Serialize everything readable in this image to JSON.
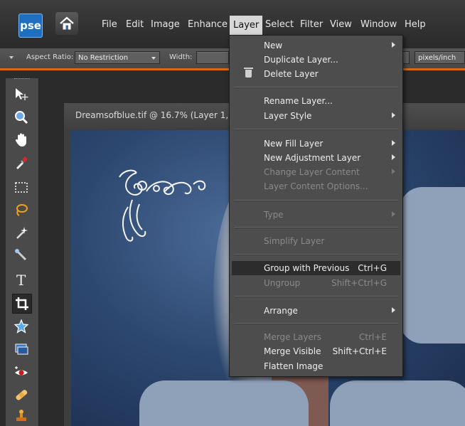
{
  "app": {
    "logo_text": "pse"
  },
  "menubar": {
    "items": [
      {
        "label": "File"
      },
      {
        "label": "Edit"
      },
      {
        "label": "Image"
      },
      {
        "label": "Enhance"
      },
      {
        "label": "Layer"
      },
      {
        "label": "Select"
      },
      {
        "label": "Filter"
      },
      {
        "label": "View"
      },
      {
        "label": "Window"
      },
      {
        "label": "Help"
      }
    ],
    "active": "Layer"
  },
  "options_bar": {
    "aspect_ratio_label": "Aspect Ratio:",
    "aspect_ratio_value": "No Restriction",
    "width_label": "Width:",
    "resolution_unit": "pixels/inch"
  },
  "document": {
    "title": "Dreamsofblue.tif @ 16.7% (Layer 1, R"
  },
  "layer_menu": {
    "items": [
      {
        "label": "New",
        "shortcut": "",
        "submenu": true,
        "disabled": false
      },
      {
        "label": "Duplicate Layer...",
        "shortcut": "",
        "submenu": false,
        "disabled": false
      },
      {
        "label": "Delete Layer",
        "shortcut": "",
        "submenu": false,
        "disabled": false,
        "icon": "trash-icon"
      },
      {
        "label": "Rename Layer...",
        "shortcut": "",
        "submenu": false,
        "disabled": false
      },
      {
        "label": "Layer Style",
        "shortcut": "",
        "submenu": true,
        "disabled": false
      },
      {
        "label": "New Fill Layer",
        "shortcut": "",
        "submenu": true,
        "disabled": false
      },
      {
        "label": "New Adjustment Layer",
        "shortcut": "",
        "submenu": true,
        "disabled": false
      },
      {
        "label": "Change Layer Content",
        "shortcut": "",
        "submenu": true,
        "disabled": true
      },
      {
        "label": "Layer Content Options...",
        "shortcut": "",
        "submenu": false,
        "disabled": true
      },
      {
        "label": "Type",
        "shortcut": "",
        "submenu": true,
        "disabled": true
      },
      {
        "label": "Simplify Layer",
        "shortcut": "",
        "submenu": false,
        "disabled": true
      },
      {
        "label": "Group with Previous",
        "shortcut": "Ctrl+G",
        "submenu": false,
        "disabled": false,
        "highlighted": true
      },
      {
        "label": "Ungroup",
        "shortcut": "Shift+Ctrl+G",
        "submenu": false,
        "disabled": true
      },
      {
        "label": "Arrange",
        "shortcut": "",
        "submenu": true,
        "disabled": false
      },
      {
        "label": "Merge Layers",
        "shortcut": "Ctrl+E",
        "submenu": false,
        "disabled": true
      },
      {
        "label": "Merge Visible",
        "shortcut": "Shift+Ctrl+E",
        "submenu": false,
        "disabled": false
      },
      {
        "label": "Flatten Image",
        "shortcut": "",
        "submenu": false,
        "disabled": false
      }
    ]
  },
  "toolbox": {
    "tools": [
      "move-tool-icon",
      "zoom-tool-icon",
      "hand-tool-icon",
      "eyedropper-tool-icon",
      "marquee-tool-icon",
      "lasso-tool-icon",
      "magic-wand-tool-icon",
      "quick-selection-tool-icon",
      "type-tool-icon",
      "crop-tool-icon",
      "cookie-cutter-tool-icon",
      "straighten-tool-icon",
      "red-eye-tool-icon",
      "healing-brush-tool-icon",
      "clone-stamp-tool-icon"
    ]
  },
  "colors": {
    "accent": "#d46b1a",
    "menu_bg": "#4d4d4d",
    "logo_blue": "#1f6fc1"
  }
}
